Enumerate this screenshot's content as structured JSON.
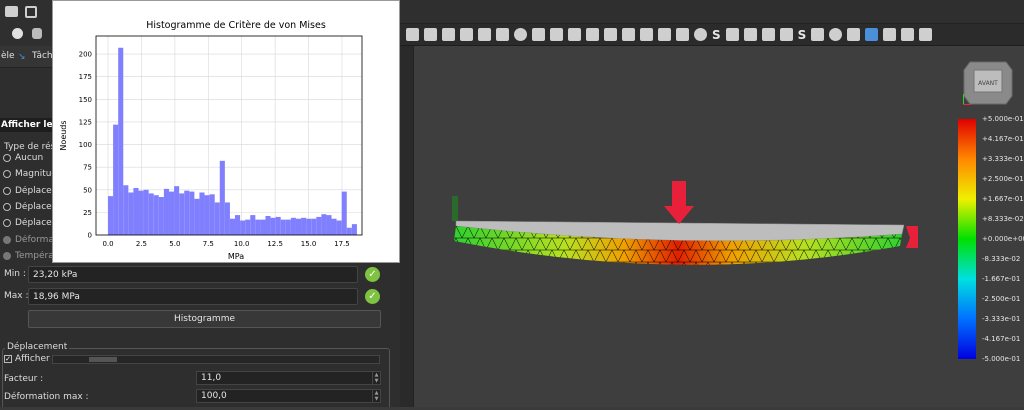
{
  "tabs": {
    "model_tab": "èle",
    "tasks_tab": "Tâch"
  },
  "results": {
    "section_title": "Afficher le ré",
    "result_type_label": "Type de résu",
    "options": [
      {
        "label": "Aucun",
        "dim": false
      },
      {
        "label": "Magnitud",
        "dim": false
      },
      {
        "label": "Déplacem",
        "dim": false
      },
      {
        "label": "Déplacem",
        "dim": false
      },
      {
        "label": "Déplacem",
        "dim": false
      },
      {
        "label": "Déformat",
        "dim": true
      },
      {
        "label": "Températ",
        "dim": true
      }
    ],
    "min_label": "Min :",
    "min_value": "23,20 kPa",
    "max_label": "Max :",
    "max_value": "18,96 MPa",
    "histogram_button": "Histogramme"
  },
  "displacement": {
    "group_title": "Déplacement",
    "show_label": "Afficher",
    "show_checked": true,
    "slider_level": 0.12,
    "factor_label": "Facteur :",
    "factor_value": "11,0",
    "max_deform_label": "Déformation max :",
    "max_deform_value": "100,0"
  },
  "navcube": {
    "face_label": "AVANT"
  },
  "colorbar": {
    "labels": [
      "+5.000e-01",
      "+4.167e-01",
      "+3.333e-01",
      "+2.500e-01",
      "+1.667e-01",
      "+8.333e-02",
      "+0.000e+00",
      "-8.333e-02",
      "-1.667e-01",
      "-2.500e-01",
      "-3.333e-01",
      "-4.167e-01",
      "-5.000e-01"
    ]
  },
  "chart_data": {
    "type": "bar",
    "title": "Histogramme de Critère de von Mises",
    "xlabel": "MPa",
    "ylabel": "Noeuds",
    "xlim": [
      -0.9,
      19.0
    ],
    "ylim": [
      0,
      220
    ],
    "xticks": [
      "0.0",
      "2.5",
      "5.0",
      "7.5",
      "10.0",
      "12.5",
      "15.0",
      "17.5"
    ],
    "yticks": [
      "0",
      "25",
      "50",
      "75",
      "100",
      "125",
      "150",
      "175",
      "200"
    ],
    "bin_start": 0.0,
    "bin_width": 0.38,
    "values": [
      43,
      122,
      207,
      55,
      47,
      52,
      49,
      50,
      46,
      44,
      42,
      51,
      48,
      54,
      46,
      49,
      48,
      40,
      47,
      44,
      45,
      36,
      82,
      36,
      18,
      22,
      16,
      17,
      22,
      17,
      17,
      21,
      19,
      20,
      17,
      17,
      19,
      18,
      19,
      18,
      18,
      20,
      23,
      22,
      18,
      16,
      48,
      8,
      12
    ],
    "bar_color": "#8080ff"
  }
}
